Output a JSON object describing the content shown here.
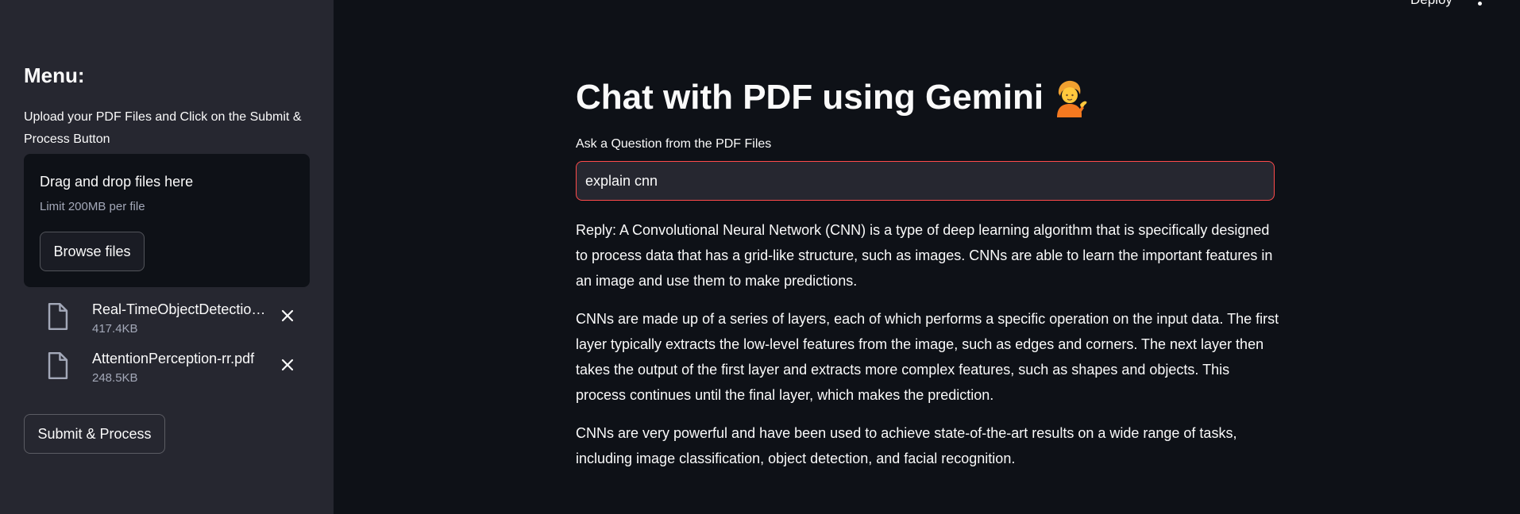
{
  "sidebar": {
    "title": "Menu:",
    "description": "Upload your PDF Files and Click on the Submit & Process Button",
    "dropzone": {
      "title": "Drag and drop files here",
      "limit": "Limit 200MB per file",
      "browse_label": "Browse files"
    },
    "files": [
      {
        "name": "Real-TimeObjectDetectio…",
        "size": "417.4KB"
      },
      {
        "name": "AttentionPerception-rr.pdf",
        "size": "248.5KB"
      }
    ],
    "submit_label": "Submit & Process"
  },
  "header": {
    "deploy_label": "Deploy",
    "menu_icon": "kebab-menu-icon"
  },
  "main": {
    "title": "Chat with PDF using Gemini",
    "title_icon": "person-tipping-hand-emoji",
    "question_label": "Ask a Question from the PDF Files",
    "question_value": "explain cnn",
    "reply": [
      "Reply: A Convolutional Neural Network (CNN) is a type of deep learning algorithm that is specifically designed to process data that has a grid-like structure, such as images. CNNs are able to learn the important features in an image and use them to make predictions.",
      "CNNs are made up of a series of layers, each of which performs a specific operation on the input data. The first layer typically extracts the low-level features from the image, such as edges and corners. The next layer then takes the output of the first layer and extracts more complex features, such as shapes and objects. This process continues until the final layer, which makes the prediction.",
      "CNNs are very powerful and have been used to achieve state-of-the-art results on a wide range of tasks, including image classification, object detection, and facial recognition."
    ]
  },
  "colors": {
    "background": "#0e1117",
    "sidebar": "#262730",
    "accent": "#ff4b4b",
    "text": "#fafafa",
    "muted": "#a3a8b8"
  }
}
